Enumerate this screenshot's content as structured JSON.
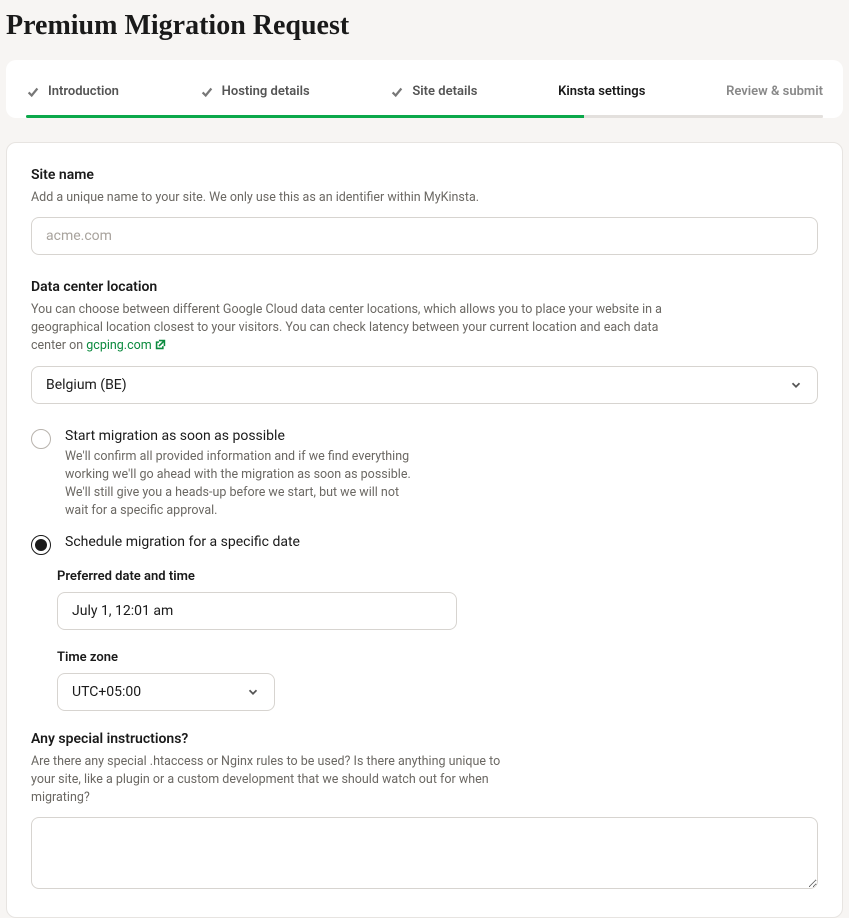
{
  "page": {
    "title": "Premium Migration Request"
  },
  "stepper": {
    "steps": [
      {
        "label": "Introduction",
        "done": true
      },
      {
        "label": "Hosting details",
        "done": true
      },
      {
        "label": "Site details",
        "done": true
      },
      {
        "label": "Kinsta settings",
        "active": true
      },
      {
        "label": "Review & submit",
        "inactive": true
      }
    ],
    "progress_done_pct": 70,
    "progress_remaining_pct": 30
  },
  "form": {
    "site_name": {
      "label": "Site name",
      "help": "Add a unique name to your site. We only use this as an identifier within MyKinsta.",
      "placeholder": "acme.com",
      "value": ""
    },
    "datacenter": {
      "label": "Data center location",
      "help_prefix": "You can choose between different Google Cloud data center locations, which allows you to place your website in a geographical location closest to your visitors. You can check latency between your current location and each data center on ",
      "link_text": "gcping.com",
      "selected": "Belgium (BE)"
    },
    "timing": {
      "asap": {
        "label": "Start migration as soon as possible",
        "help": "We'll confirm all provided information and if we find everything working we'll go ahead with the migration as soon as possible. We'll still give you a heads-up before we start, but we will not wait for a specific approval."
      },
      "scheduled": {
        "label": "Schedule migration for a specific date",
        "preferred_label": "Preferred date and time",
        "preferred_value": "July 1, 12:01 am",
        "tz_label": "Time zone",
        "tz_value": "UTC+05:00"
      }
    },
    "special": {
      "label": "Any special instructions?",
      "help": "Are there any special .htaccess or Nginx rules to be used? Is there anything unique to your site, like a plugin or a custom development that we should watch out for when migrating?",
      "value": ""
    }
  }
}
